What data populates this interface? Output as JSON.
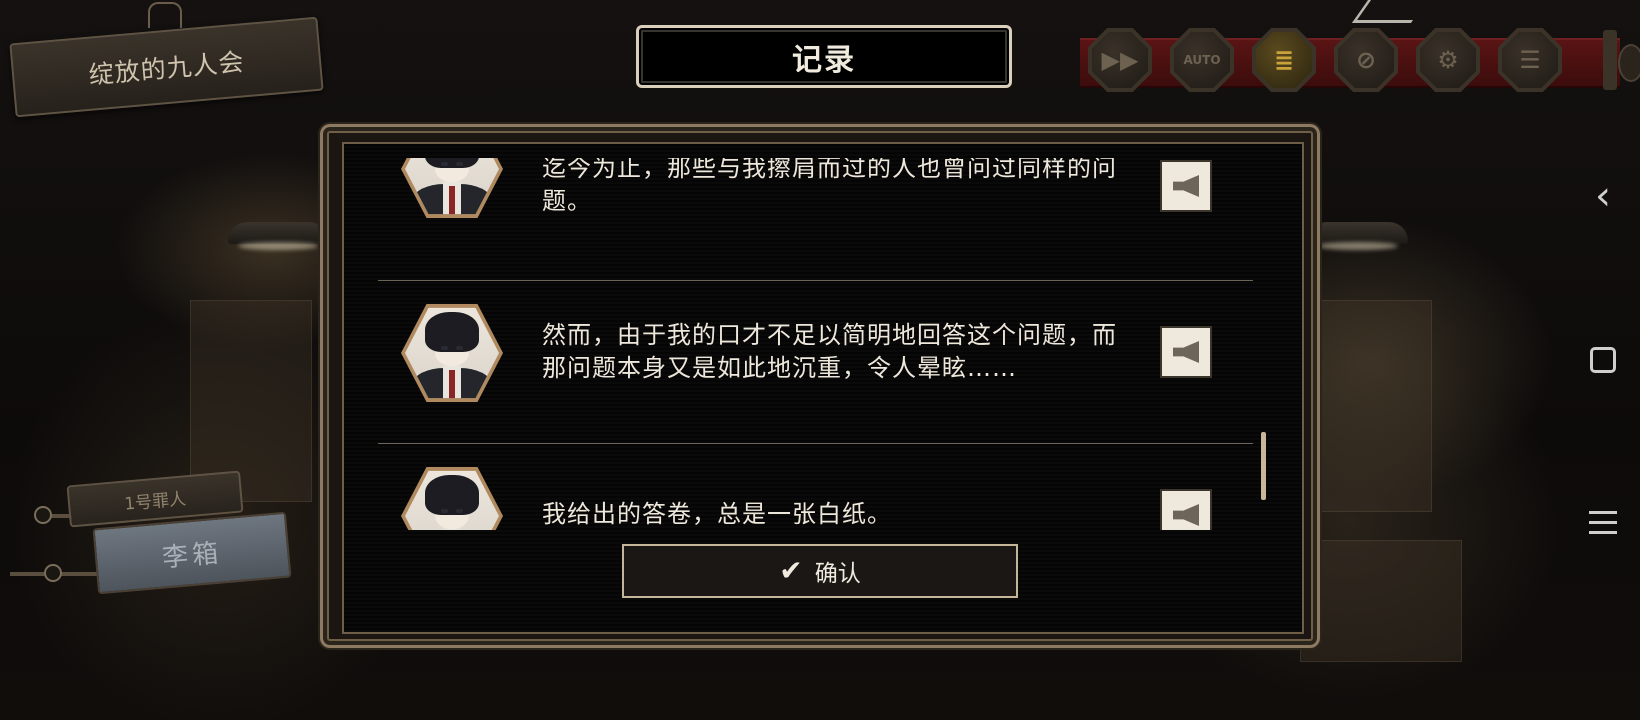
{
  "chapter_title": "绽放的九人会",
  "dialog_title": "记录",
  "toolbar": {
    "buttons": [
      {
        "name": "fast-forward",
        "glyph": "▶▶"
      },
      {
        "name": "auto",
        "glyph": "AUTO"
      },
      {
        "name": "log",
        "glyph": "≣"
      },
      {
        "name": "skip-disabled",
        "glyph": "⊘"
      },
      {
        "name": "settings",
        "glyph": "⚙"
      },
      {
        "name": "menu",
        "glyph": "☰"
      }
    ],
    "active_button": "log",
    "strip_color": "#4a1010"
  },
  "character": {
    "number_label": "1号罪人",
    "name": "李箱"
  },
  "log_entries": [
    {
      "text": "迄今为止，那些与我擦肩而过的人也曾问过同样的问题。"
    },
    {
      "text": "然而，由于我的口才不足以简明地回答这个问题，而那问题本身又是如此地沉重，令人晕眩……"
    },
    {
      "text": "我给出的答卷，总是一张白纸。"
    }
  ],
  "confirm_button": {
    "label": "确认",
    "icon": "check-icon"
  },
  "android_nav": {
    "back": "‹"
  },
  "colors": {
    "accent_gold": "#c6b699",
    "text_cream": "#eee7db",
    "panel_border": "#8d7a60"
  }
}
